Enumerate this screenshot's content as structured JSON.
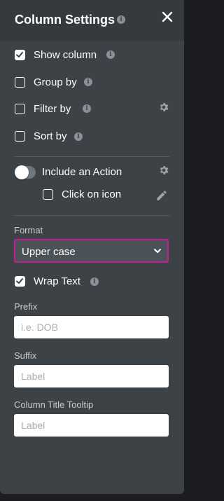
{
  "panel": {
    "title": "Column Settings",
    "info_glyph": "i",
    "accent_color": "#c21f96"
  },
  "options": {
    "show_column": {
      "label": "Show column",
      "checked": true
    },
    "group_by": {
      "label": "Group by",
      "checked": false
    },
    "filter_by": {
      "label": "Filter by",
      "checked": false
    },
    "sort_by": {
      "label": "Sort by",
      "checked": false
    }
  },
  "action": {
    "include_label": "Include an Action",
    "include_on": false,
    "click_on_icon_label": "Click on icon",
    "click_on_icon_checked": false
  },
  "format": {
    "label": "Format",
    "selected": "Upper case"
  },
  "wrap_text": {
    "label": "Wrap Text",
    "checked": true
  },
  "fields": {
    "prefix": {
      "label": "Prefix",
      "placeholder": "i.e. DOB",
      "value": ""
    },
    "suffix": {
      "label": "Suffix",
      "placeholder": "Label",
      "value": ""
    },
    "tooltip": {
      "label": "Column Title Tooltip",
      "placeholder": "Label",
      "value": ""
    }
  },
  "icons": {
    "close": "close-icon",
    "info": "info-icon",
    "gear": "gear-icon",
    "pencil": "pencil-icon",
    "chevron": "chevron-down-icon",
    "check": "check-icon"
  }
}
